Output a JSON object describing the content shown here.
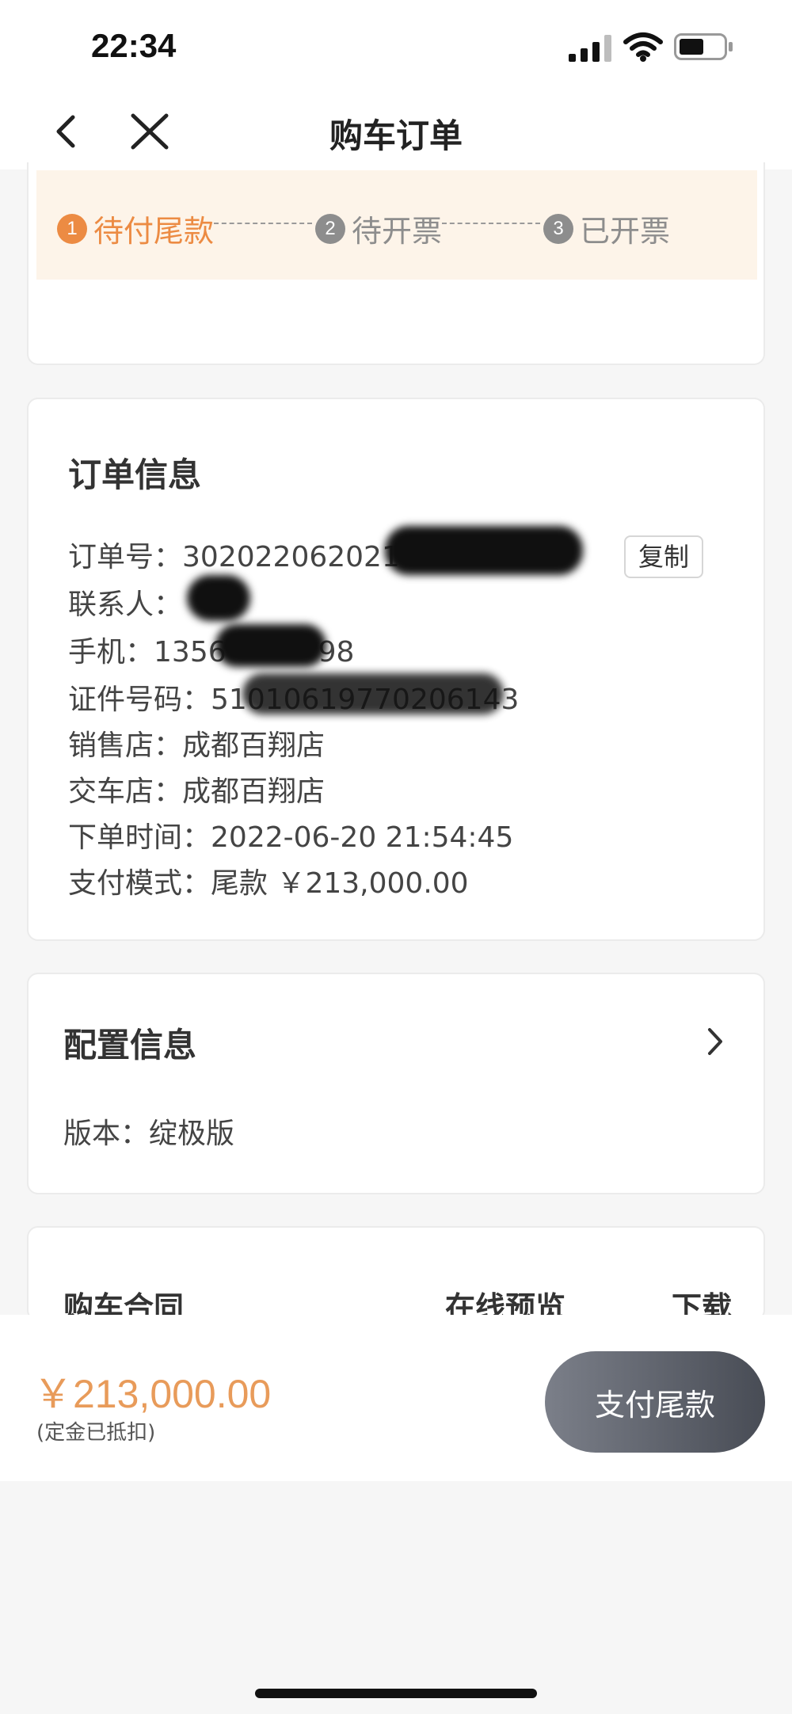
{
  "status_bar": {
    "time": "22:34"
  },
  "nav": {
    "title": "购车订单"
  },
  "progress": {
    "steps": [
      {
        "num": "1",
        "label": "待付尾款"
      },
      {
        "num": "2",
        "label": "待开票"
      },
      {
        "num": "3",
        "label": "已开票"
      }
    ]
  },
  "order_info": {
    "title": "订单信息",
    "order_no_label": "订单号：",
    "order_no_value": "302022062021",
    "copy_label": "复制",
    "contact_label": "联系人：",
    "phone_label": "手机：",
    "phone_value": "1356",
    "phone_value_tail": "98",
    "id_label": "证件号码：",
    "id_value": "51010619770206143",
    "sales_store_label": "销售店：",
    "sales_store_value": "成都百翔店",
    "delivery_store_label": "交车店：",
    "delivery_store_value": "成都百翔店",
    "order_time_label": "下单时间：",
    "order_time_value": "2022-06-20 21:54:45",
    "payment_mode_label": "支付模式：",
    "payment_mode_value": "尾款 ￥213,000.00"
  },
  "config_info": {
    "title": "配置信息",
    "version_label": "版本：",
    "version_value": "绽极版"
  },
  "contract": {
    "title": "购车合同",
    "preview_label": "在线预览",
    "download_label": "下载"
  },
  "pay_bar": {
    "amount": "￥213,000.00",
    "note": "(定金已抵扣)",
    "pay_label": "支付尾款"
  },
  "colors": {
    "accent": "#ec8b43",
    "amount": "#e89b5a",
    "progress_bg": "#fdf4e9",
    "inactive_step": "#8d8d8d"
  }
}
